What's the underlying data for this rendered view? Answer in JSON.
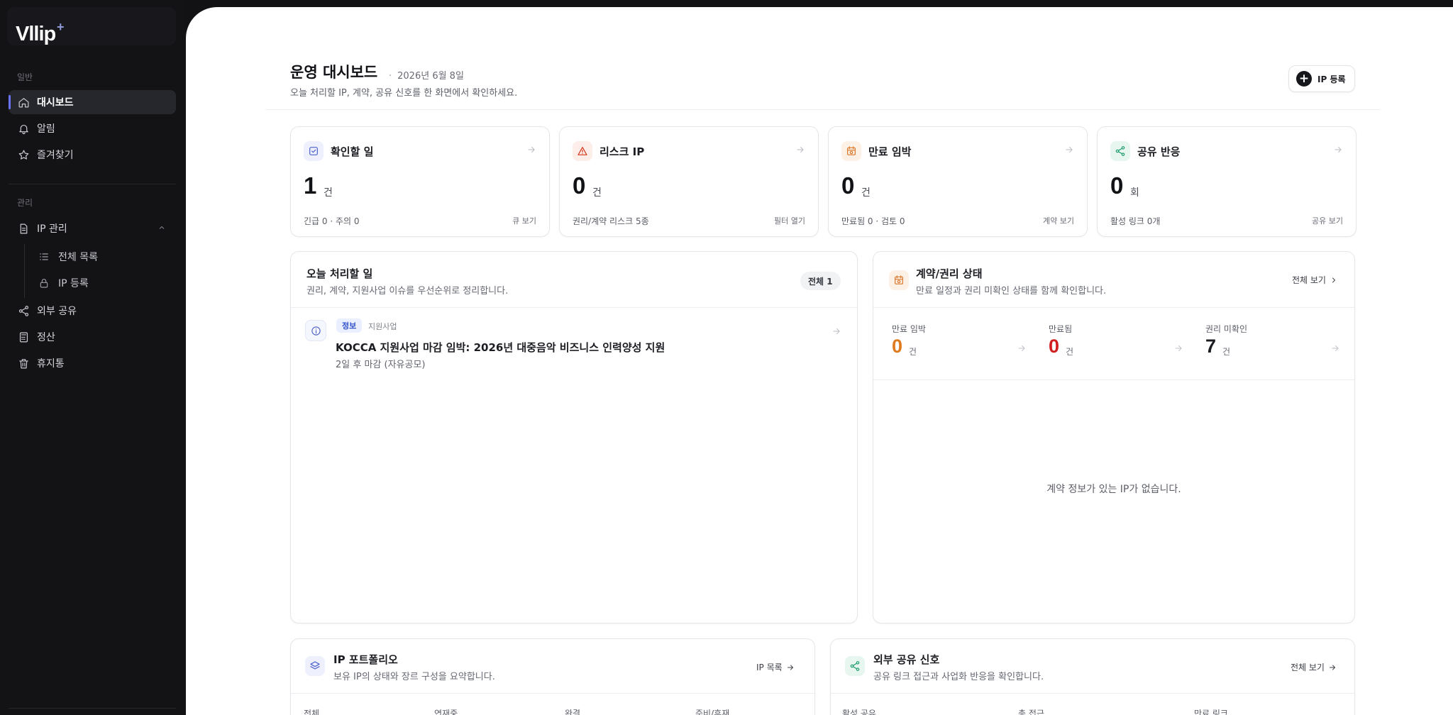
{
  "sidebar": {
    "logo": "Vllip",
    "logo_mark": "+",
    "section_general": "일반",
    "section_manage": "관리",
    "items": [
      {
        "label": "대시보드",
        "icon": "home-icon"
      },
      {
        "label": "알림",
        "icon": "bell-icon"
      },
      {
        "label": "즐겨찾기",
        "icon": "star-icon"
      },
      {
        "label": "IP 관리",
        "icon": "document-icon"
      },
      {
        "label": "전체 목록",
        "icon": "list-icon"
      },
      {
        "label": "IP 등록",
        "icon": "lock-icon"
      },
      {
        "label": "외부 공유",
        "icon": "share-icon"
      },
      {
        "label": "정산",
        "icon": "calculator-icon"
      },
      {
        "label": "휴지통",
        "icon": "trash-icon"
      }
    ]
  },
  "header": {
    "title": "운영 대시보드",
    "date": "2026년 6월 8일",
    "subtitle": "오늘 처리할 IP, 계약, 공유 신호를 한 화면에서 확인하세요.",
    "register_button": "IP 등록"
  },
  "stats": [
    {
      "title": "확인할 일",
      "value": "1",
      "unit": "건",
      "foot": "긴급 0 · 주의 0",
      "link": "큐 보기",
      "icon": "check-square-icon",
      "color": "#4c61c9"
    },
    {
      "title": "리스크 IP",
      "value": "0",
      "unit": "건",
      "foot": "권리/계약 리스크 5종",
      "link": "필터 열기",
      "icon": "warning-icon",
      "color": "#d4371c"
    },
    {
      "title": "만료 임박",
      "value": "0",
      "unit": "건",
      "foot": "만료됨 0 · 검토 0",
      "link": "계약 보기",
      "icon": "calendar-clock-icon",
      "color": "#d9772b"
    },
    {
      "title": "공유 반응",
      "value": "0",
      "unit": "회",
      "foot": "활성 링크 0개",
      "link": "공유 보기",
      "icon": "share-icon",
      "color": "#1f9d73"
    }
  ],
  "today_tasks": {
    "title": "오늘 처리할 일",
    "subtitle": "권리, 계약, 지원사업 이슈를 우선순위로 정리합니다.",
    "badge": "전체 1",
    "items": [
      {
        "chip": "정보",
        "category": "지원사업",
        "title": "KOCCA 지원사업 마감 임박: 2026년 대중음악 비즈니스 인력양성 지원",
        "sub": "2일 후 마감 (자유공모)"
      }
    ]
  },
  "contract_status": {
    "title": "계약/권리 상태",
    "subtitle": "만료 일정과 권리 미확인 상태를 함께 확인합니다.",
    "link": "전체 보기",
    "metrics": [
      {
        "label": "만료 임박",
        "value": "0",
        "unit": "건",
        "color": "#df7a1f"
      },
      {
        "label": "만료됨",
        "value": "0",
        "unit": "건",
        "color": "#d11f1f"
      },
      {
        "label": "권리 미확인",
        "value": "7",
        "unit": "건",
        "color": "#1b1c21"
      }
    ],
    "empty": "계약 정보가 있는 IP가 없습니다."
  },
  "portfolio": {
    "title": "IP 포트폴리오",
    "subtitle": "보유 IP의 상태와 장르 구성을 요약합니다.",
    "link": "IP 목록",
    "columns": [
      "전체",
      "연재중",
      "완결",
      "준비/휴재"
    ]
  },
  "external_share": {
    "title": "외부 공유 신호",
    "subtitle": "공유 링크 접근과 사업화 반응을 확인합니다.",
    "link": "전체 보기",
    "columns": [
      "활성 공유",
      "총 접근",
      "만료 링크"
    ]
  }
}
